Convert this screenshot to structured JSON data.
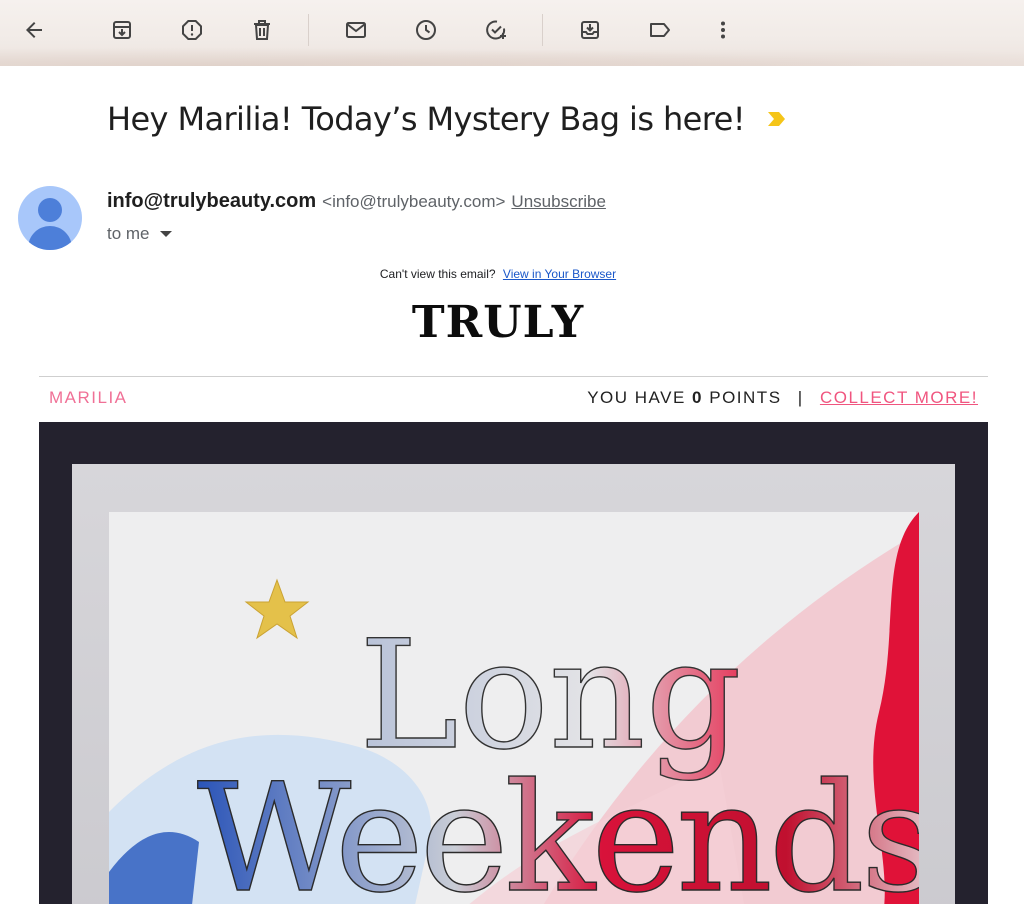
{
  "toolbar": {
    "items": [
      "back-arrow-icon",
      "archive-icon",
      "report-spam-icon",
      "delete-icon",
      "mark-unread-icon",
      "snooze-icon",
      "add-task-icon",
      "move-to-icon",
      "label-icon",
      "more-options-icon"
    ]
  },
  "email": {
    "subject": "Hey Marilia! Today’s Mystery Bag is here!",
    "sender_name": "info@trulybeauty.com",
    "sender_email": "<info@trulybeauty.com>",
    "unsubscribe": "Unsubscribe",
    "recipient": "to me"
  },
  "content": {
    "preheader_text": "Can't view this email?",
    "view_in_browser": "View in Your Browser",
    "brand": "TRULY",
    "customer_name": "MARILIA",
    "points_prefix": "YOU HAVE",
    "points_value": "0",
    "points_suffix": "POINTS",
    "separator": "|",
    "collect_more": "COLLECT MORE!",
    "hero_line1": "Long",
    "hero_line2": "Weekends"
  },
  "colors": {
    "accent_pink": "#f0557f",
    "link_blue": "#1a57c9",
    "importance_yellow": "#f5c518",
    "hero_background": "#24222e"
  }
}
